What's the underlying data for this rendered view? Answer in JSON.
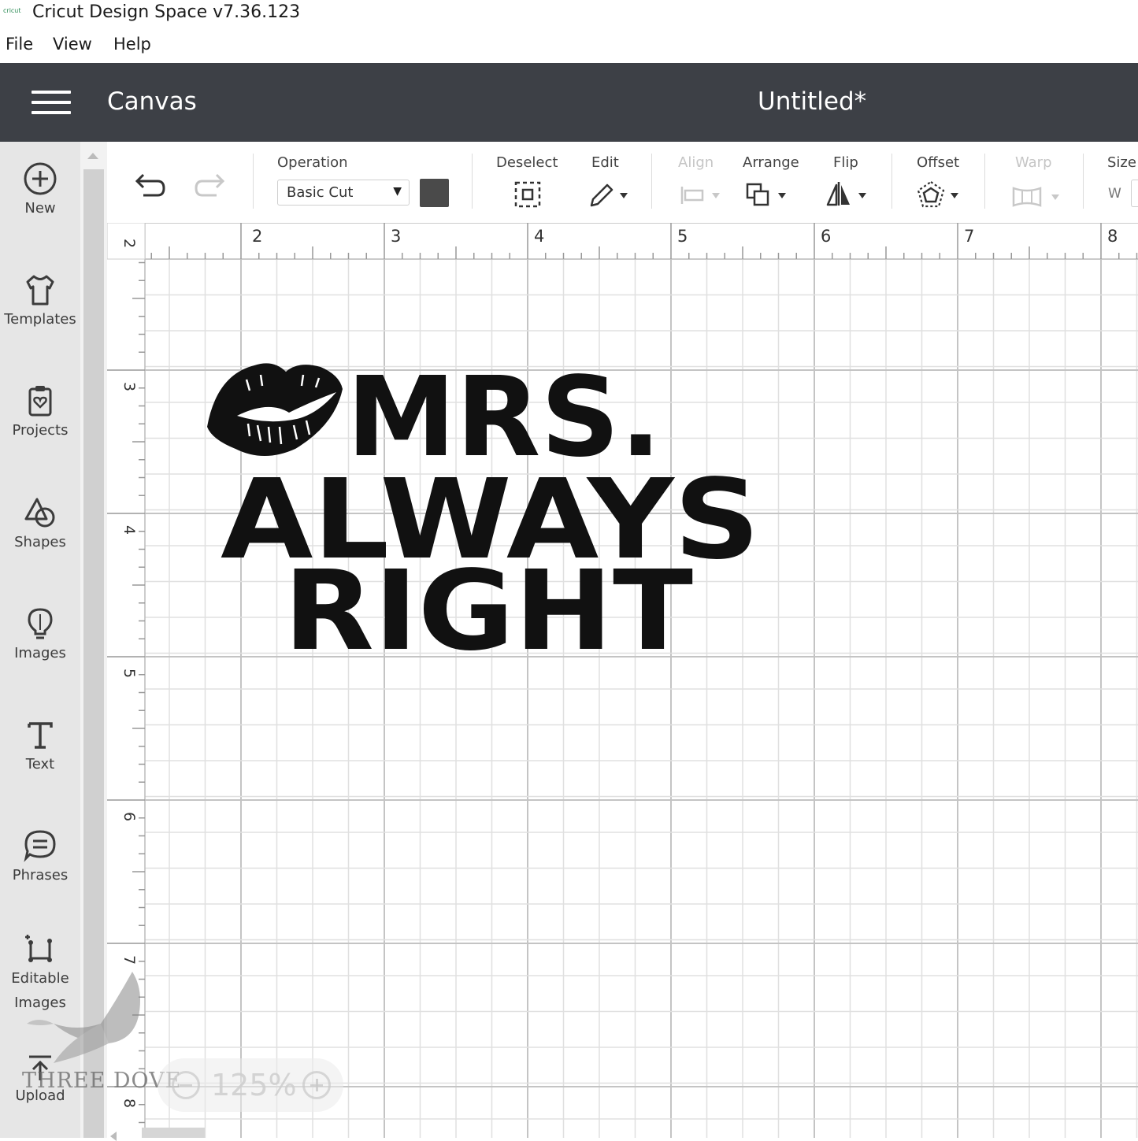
{
  "window": {
    "app_logo": "cricut",
    "title": "Cricut Design Space  v7.36.123"
  },
  "menu": [
    "File",
    "View",
    "Help"
  ],
  "header": {
    "section": "Canvas",
    "document_title": "Untitled*"
  },
  "sidebar": [
    {
      "label": "New",
      "icon": "plus-circle-icon"
    },
    {
      "label": "Templates",
      "icon": "tshirt-icon"
    },
    {
      "label": "Projects",
      "icon": "clipboard-heart-icon"
    },
    {
      "label": "Shapes",
      "icon": "shapes-icon"
    },
    {
      "label": "Images",
      "icon": "lightbulb-icon"
    },
    {
      "label": "Text",
      "icon": "text-t-icon"
    },
    {
      "label": "Phrases",
      "icon": "speech-bubble-icon"
    },
    {
      "label": "Editable",
      "label2": "Images",
      "icon": "editable-image-icon"
    },
    {
      "label": "Upload",
      "icon": "upload-icon"
    }
  ],
  "toolbar": {
    "operation_label": "Operation",
    "operation_value": "Basic Cut",
    "operation_color": "#4a4a4a",
    "deselect": "Deselect",
    "edit": "Edit",
    "align": "Align",
    "arrange": "Arrange",
    "flip": "Flip",
    "offset": "Offset",
    "warp": "Warp",
    "size": "Size",
    "size_w": "W"
  },
  "ruler": {
    "horizontal": [
      "2",
      "3",
      "4",
      "5",
      "6",
      "7",
      "8"
    ],
    "vertical": [
      "2",
      "3",
      "4",
      "5",
      "6",
      "7",
      "8"
    ]
  },
  "design": {
    "lines": [
      "MRS.",
      "ALWAYS",
      "RIGHT"
    ],
    "icon": "lips-icon"
  },
  "zoom": {
    "level": "125%"
  },
  "watermark": "THREE DOVE"
}
